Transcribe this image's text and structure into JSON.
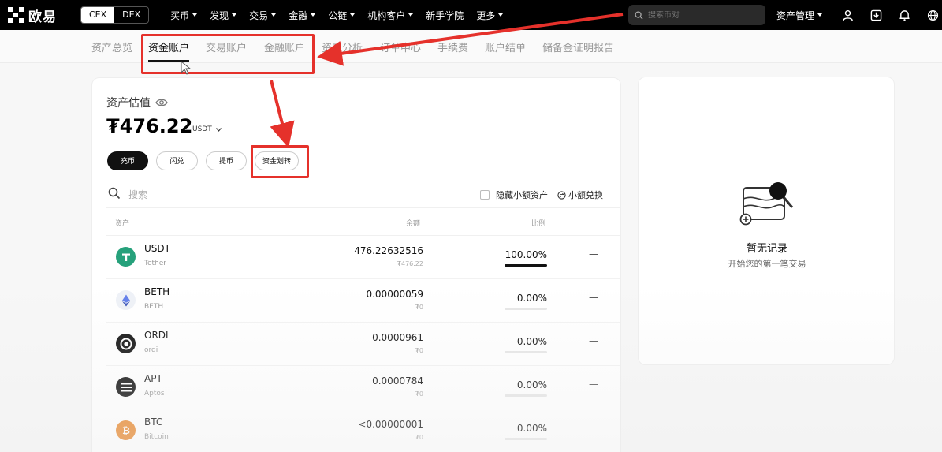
{
  "topnav": {
    "logo_text": "欧易",
    "seg": [
      "CEX",
      "DEX"
    ],
    "items": [
      "买币",
      "发现",
      "交易",
      "金融",
      "公链",
      "机构客户",
      "新手学院",
      "更多"
    ],
    "search_placeholder": "搜索币对",
    "asset_manage": "资产管理"
  },
  "subnav": {
    "items": [
      "资产总览",
      "资金账户",
      "交易账户",
      "金融账户",
      "资产分析",
      "订单中心",
      "手续费",
      "账户结单",
      "储备金证明报告"
    ]
  },
  "assets": {
    "est_label": "资产估值",
    "amount": "₮476.22",
    "unit": "USDT",
    "buttons": [
      "充币",
      "闪兑",
      "提币",
      "资金划转"
    ],
    "search_placeholder": "搜索",
    "hide_small": "隐藏小额资产",
    "small_convert": "小额兑换",
    "headers": {
      "asset": "资产",
      "balance": "余额",
      "ratio": "比例"
    },
    "rows": [
      {
        "symbol": "USDT",
        "name": "Tether",
        "balance": "476.22632516",
        "value": "₮476.22",
        "pct": "100.00%",
        "ratio": 1.0,
        "action": "—"
      },
      {
        "symbol": "BETH",
        "name": "BETH",
        "balance": "0.00000059",
        "value": "₮0",
        "pct": "0.00%",
        "ratio": 0.0,
        "action": "—"
      },
      {
        "symbol": "ORDI",
        "name": "ordi",
        "balance": "0.0000961",
        "value": "₮0",
        "pct": "0.00%",
        "ratio": 0.0,
        "action": "—"
      },
      {
        "symbol": "APT",
        "name": "Aptos",
        "balance": "0.0000784",
        "value": "₮0",
        "pct": "0.00%",
        "ratio": 0.0,
        "action": "—"
      },
      {
        "symbol": "BTC",
        "name": "Bitcoin",
        "balance": "<0.00000001",
        "value": "₮0",
        "pct": "0.00%",
        "ratio": 0.0,
        "action": "—"
      }
    ]
  },
  "records": {
    "title": "暂无记录",
    "subtitle": "开始您的第一笔交易"
  },
  "colors": {
    "annotation_red": "#e5312b",
    "usdt_green": "#26a17b",
    "btc_orange": "#e8892f"
  }
}
